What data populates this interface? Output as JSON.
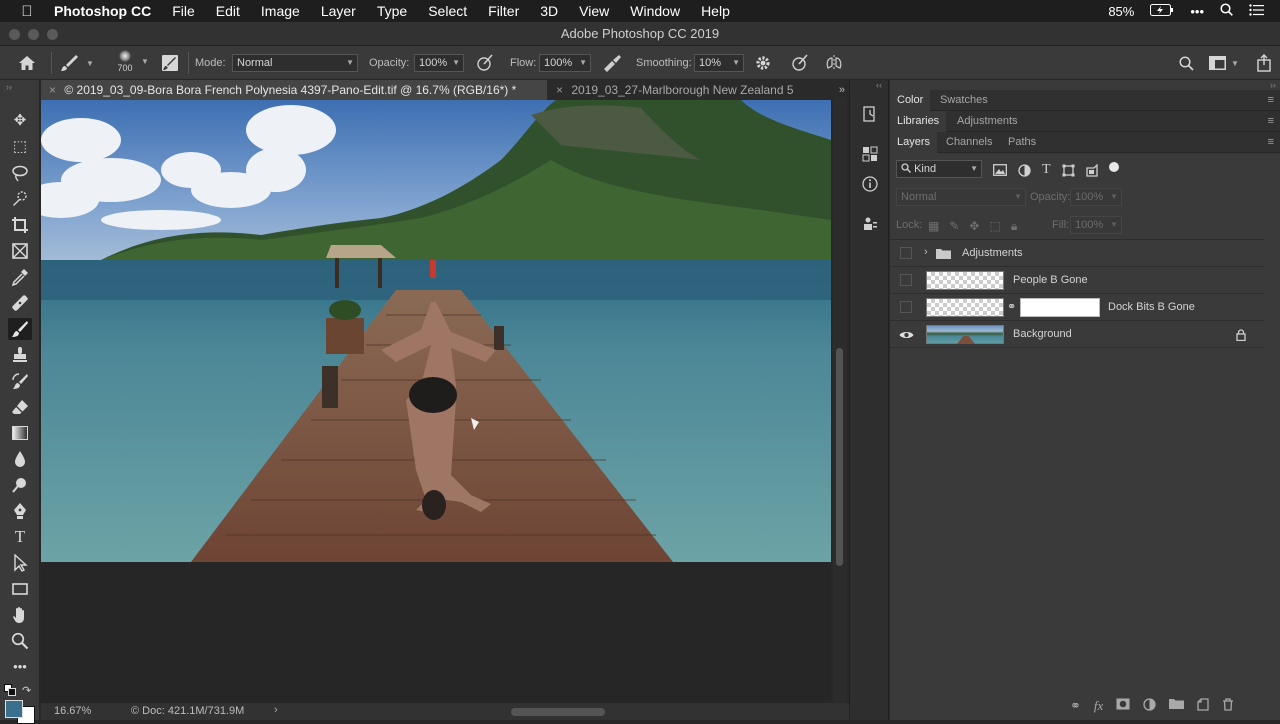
{
  "menubar": {
    "app_name": "Photoshop CC",
    "items": [
      "File",
      "Edit",
      "Image",
      "Layer",
      "Type",
      "Select",
      "Filter",
      "3D",
      "View",
      "Window",
      "Help"
    ],
    "battery": "85%"
  },
  "window": {
    "title": "Adobe Photoshop CC 2019"
  },
  "options_bar": {
    "brush_size": "700",
    "mode_label": "Mode:",
    "mode_value": "Normal",
    "opacity_label": "Opacity:",
    "opacity_value": "100%",
    "flow_label": "Flow:",
    "flow_value": "100%",
    "smoothing_label": "Smoothing:",
    "smoothing_value": "10%"
  },
  "document_tabs": [
    {
      "label": "2019_03_09-Bora Bora French Polynesia 4397-Pano-Edit.tif @ 16.7% (RGB/16*) *",
      "active": true
    },
    {
      "label": "2019_03_27-Marlborough New Zealand 5",
      "active": false
    }
  ],
  "status_bar": {
    "zoom": "16.67%",
    "doc_info": "Doc: 421.1M/731.9M"
  },
  "panels": {
    "group1_tabs": [
      "Color",
      "Swatches"
    ],
    "group2_tabs": [
      "Libraries",
      "Adjustments"
    ],
    "group3_tabs": [
      "Layers",
      "Channels",
      "Paths"
    ],
    "filter_kind": "Kind",
    "blend_mode": "Normal",
    "opacity_label": "Opacity:",
    "opacity_value": "100%",
    "lock_label": "Lock:",
    "fill_label": "Fill:",
    "fill_value": "100%"
  },
  "layers": [
    {
      "name": "Adjustments",
      "type": "group",
      "visible": false
    },
    {
      "name": "People B Gone",
      "type": "pixel",
      "visible": false
    },
    {
      "name": "Dock Bits B Gone",
      "type": "pixel-mask",
      "visible": false
    },
    {
      "name": "Background",
      "type": "background",
      "visible": true,
      "locked": true
    }
  ]
}
